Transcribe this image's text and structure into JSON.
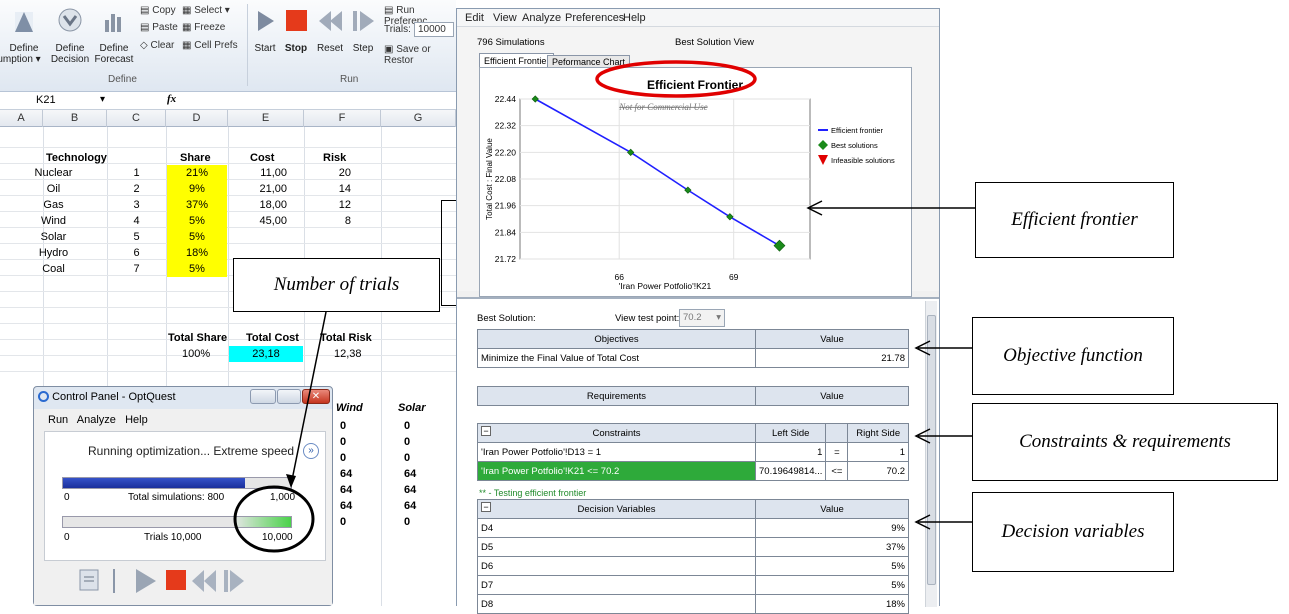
{
  "ribbon": {
    "buttons": [
      "Define Assumption",
      "Define Decision",
      "Define Forecast"
    ],
    "define_label_1": "Define",
    "define_label_2": "umption ▾",
    "decision_1": "Define",
    "decision_2": "Decision",
    "forecast_1": "Define",
    "forecast_2": "Forecast",
    "copy": "Copy",
    "paste": "Paste",
    "clear": "Clear",
    "select": "Select ▾",
    "freeze": "Freeze",
    "cell_prefs": "Cell Prefs",
    "group_define": "Define",
    "start": "Start",
    "stop": "Stop",
    "reset": "Reset",
    "step": "Step",
    "group_run": "Run",
    "run_pref": "Run Preferenc",
    "trials_label": "Trials:",
    "trials_value": "10000",
    "save_restore": "Save or Restor"
  },
  "formula_bar": {
    "name_box": "K21",
    "fx": "fx"
  },
  "sheet": {
    "columns": [
      "A",
      "B",
      "C",
      "D",
      "E",
      "F",
      "G"
    ],
    "headers": [
      "Technology",
      "Share",
      "Cost",
      "Risk"
    ],
    "rows": [
      {
        "tech": "Nuclear",
        "n": "1",
        "share": "21%",
        "cost": "11,00",
        "risk": "20"
      },
      {
        "tech": "Oil",
        "n": "2",
        "share": "9%",
        "cost": "21,00",
        "risk": "14"
      },
      {
        "tech": "Gas",
        "n": "3",
        "share": "37%",
        "cost": "18,00",
        "risk": "12"
      },
      {
        "tech": "Wind",
        "n": "4",
        "share": "5%",
        "cost": "45,00",
        "risk": "8"
      },
      {
        "tech": "Solar",
        "n": "5",
        "share": "5%",
        "cost": "",
        "risk": ""
      },
      {
        "tech": "Hydro",
        "n": "6",
        "share": "18%",
        "cost": "",
        "risk": ""
      },
      {
        "tech": "Coal",
        "n": "7",
        "share": "5%",
        "cost": "",
        "risk": ""
      }
    ],
    "total_share_label": "Total Share",
    "total_cost_label": "Total Cost",
    "total_risk_label": "Total Risk",
    "total_share": "100%",
    "total_cost": "23,18",
    "total_risk": "12,38",
    "wind_header": "Wind",
    "solar_header": "Solar",
    "lower_rows": [
      [
        "0",
        "0"
      ],
      [
        "0",
        "0"
      ],
      [
        "0",
        "0"
      ],
      [
        "64",
        "64"
      ],
      [
        "64",
        "64"
      ],
      [
        "64",
        "64"
      ],
      [
        "0",
        "0"
      ]
    ]
  },
  "app": {
    "menu": [
      "Edit",
      "View",
      "Analyze",
      "Preferences",
      "Help"
    ],
    "simulations": "796 Simulations",
    "view_title": "Best Solution View",
    "tabs": [
      "Efficient Frontier",
      "Peformance Chart"
    ],
    "best_solution_label": "Best Solution:",
    "view_test_point_label": "View test point:",
    "view_test_point": "70.2",
    "objectives_header": "Objectives",
    "value_header": "Value",
    "objective_row": "Minimize the Final Value of Total Cost",
    "objective_value": "21.78",
    "requirements_header": "Requirements",
    "constraints_header": "Constraints",
    "left_side_header": "Left Side",
    "right_side_header": "Right Side",
    "constraints": [
      {
        "name": "'Iran Power Potfolio'!D13 = 1",
        "left": "1",
        "op": "=",
        "right": "1"
      },
      {
        "name": "'Iran Power Potfolio'!K21 <= 70.2",
        "left": "70.19649814...",
        "op": "<=",
        "right": "70.2"
      }
    ],
    "testing_note": "** - Testing efficient frontier",
    "decision_header": "Decision Variables",
    "decisions": [
      {
        "name": "D4",
        "value": "9%"
      },
      {
        "name": "D5",
        "value": "37%"
      },
      {
        "name": "D6",
        "value": "5%"
      },
      {
        "name": "D7",
        "value": "5%"
      },
      {
        "name": "D8",
        "value": "18%"
      }
    ]
  },
  "chart_data": {
    "type": "line",
    "title": "Efficient Frontier",
    "watermark": "Not for Commercial Use",
    "xlabel": "'Iran Power Potfolio'!K21",
    "ylabel": "Total Cost : Final Value",
    "xlim": [
      63.4,
      71.0
    ],
    "ylim": [
      21.72,
      22.44
    ],
    "xticks": [
      "66",
      "69"
    ],
    "yticks": [
      "22.44",
      "22.32",
      "22.20",
      "22.08",
      "21.96",
      "21.84",
      "21.72"
    ],
    "series": [
      {
        "name": "Efficient frontier",
        "x": [
          63.8,
          66.3,
          67.8,
          68.9,
          70.2
        ],
        "y": [
          22.44,
          22.2,
          22.03,
          21.91,
          21.78
        ]
      }
    ],
    "legend": [
      "Efficient frontier",
      "Best solutions",
      "Infeasible solutions"
    ],
    "legend_position": "right"
  },
  "control_panel": {
    "title": "Control Panel - OptQuest",
    "menu": [
      "Run",
      "Analyze",
      "Help"
    ],
    "status": "Running optimization... Extreme speed",
    "sim_bar_min": "0",
    "sim_bar_label": "Total simulations: 800",
    "sim_bar_max": "1,000",
    "sim_progress": 0.8,
    "trial_bar_min": "0",
    "trial_bar_label": "Trials 10,000",
    "trial_bar_max": "10,000",
    "trial_progress": 1.0
  },
  "callouts": {
    "trials": "Number of trials",
    "frontier": "Efficient frontier",
    "objective": "Objective function",
    "constraints": "Constraints & requirements",
    "decision": "Decision variables"
  },
  "colors": {
    "highlight_yellow": "#ffff00",
    "cyan": "#00ffff",
    "red_ellipse": "#e00000",
    "line_blue": "#2020ff",
    "marker_green": "#1a8a1a",
    "constraint_green": "#2eaa3a"
  }
}
